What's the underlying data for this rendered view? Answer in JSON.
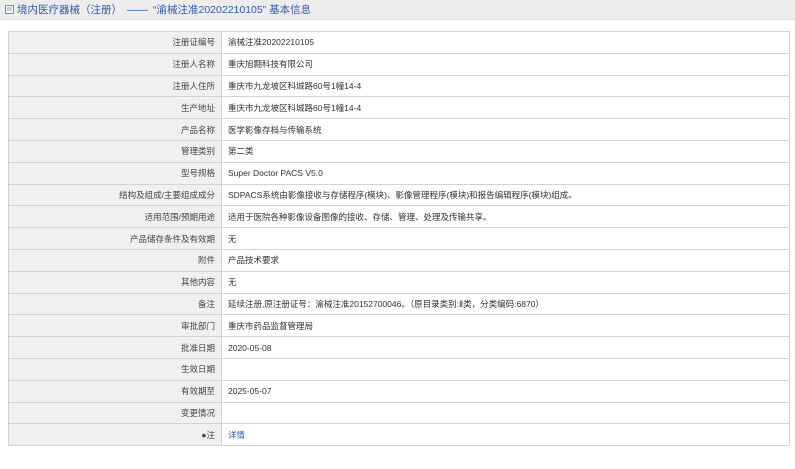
{
  "header": {
    "breadcrumb_part1": "境内医疗器械（注册）",
    "separator": "——",
    "breadcrumb_part2": "“渝械注准20202210105” 基本信息",
    "icon": "document-icon"
  },
  "rows": [
    {
      "label": "注册证编号",
      "value": "渝械注准20202210105"
    },
    {
      "label": "注册人名称",
      "value": "重庆旭翾科技有限公司"
    },
    {
      "label": "注册人住所",
      "value": "重庆市九龙坡区科城路60号1幢14-4"
    },
    {
      "label": "生产地址",
      "value": "重庆市九龙坡区科城路60号1幢14-4"
    },
    {
      "label": "产品名称",
      "value": "医学影像存档与传输系统"
    },
    {
      "label": "管理类别",
      "value": "第二类"
    },
    {
      "label": "型号规格",
      "value": "Super Doctor PACS V5.0"
    },
    {
      "label": "结构及组成/主要组成成分",
      "value": "SDPACS系统由影像接收与存储程序(模块)、影像管理程序(模块)和报告编辑程序(模块)组成。"
    },
    {
      "label": "适用范围/预期用途",
      "value": "适用于医院各种影像设备图像的接收、存储、管理、处理及传输共享。"
    },
    {
      "label": "产品储存条件及有效期",
      "value": "无"
    },
    {
      "label": "附件",
      "value": "产品技术要求"
    },
    {
      "label": "其他内容",
      "value": "无"
    },
    {
      "label": "备注",
      "value": "延续注册,原注册证号：渝械注准20152700046。（原目录类别:Ⅱ类，分类编码:6870）"
    },
    {
      "label": "审批部门",
      "value": "重庆市药品监督管理局"
    },
    {
      "label": "批准日期",
      "value": "2020-05-08"
    },
    {
      "label": "生效日期",
      "value": ""
    },
    {
      "label": "有效期至",
      "value": "2025-05-07"
    },
    {
      "label": "变更情况",
      "value": ""
    },
    {
      "label": "●注",
      "value": "详情",
      "link": true
    }
  ]
}
